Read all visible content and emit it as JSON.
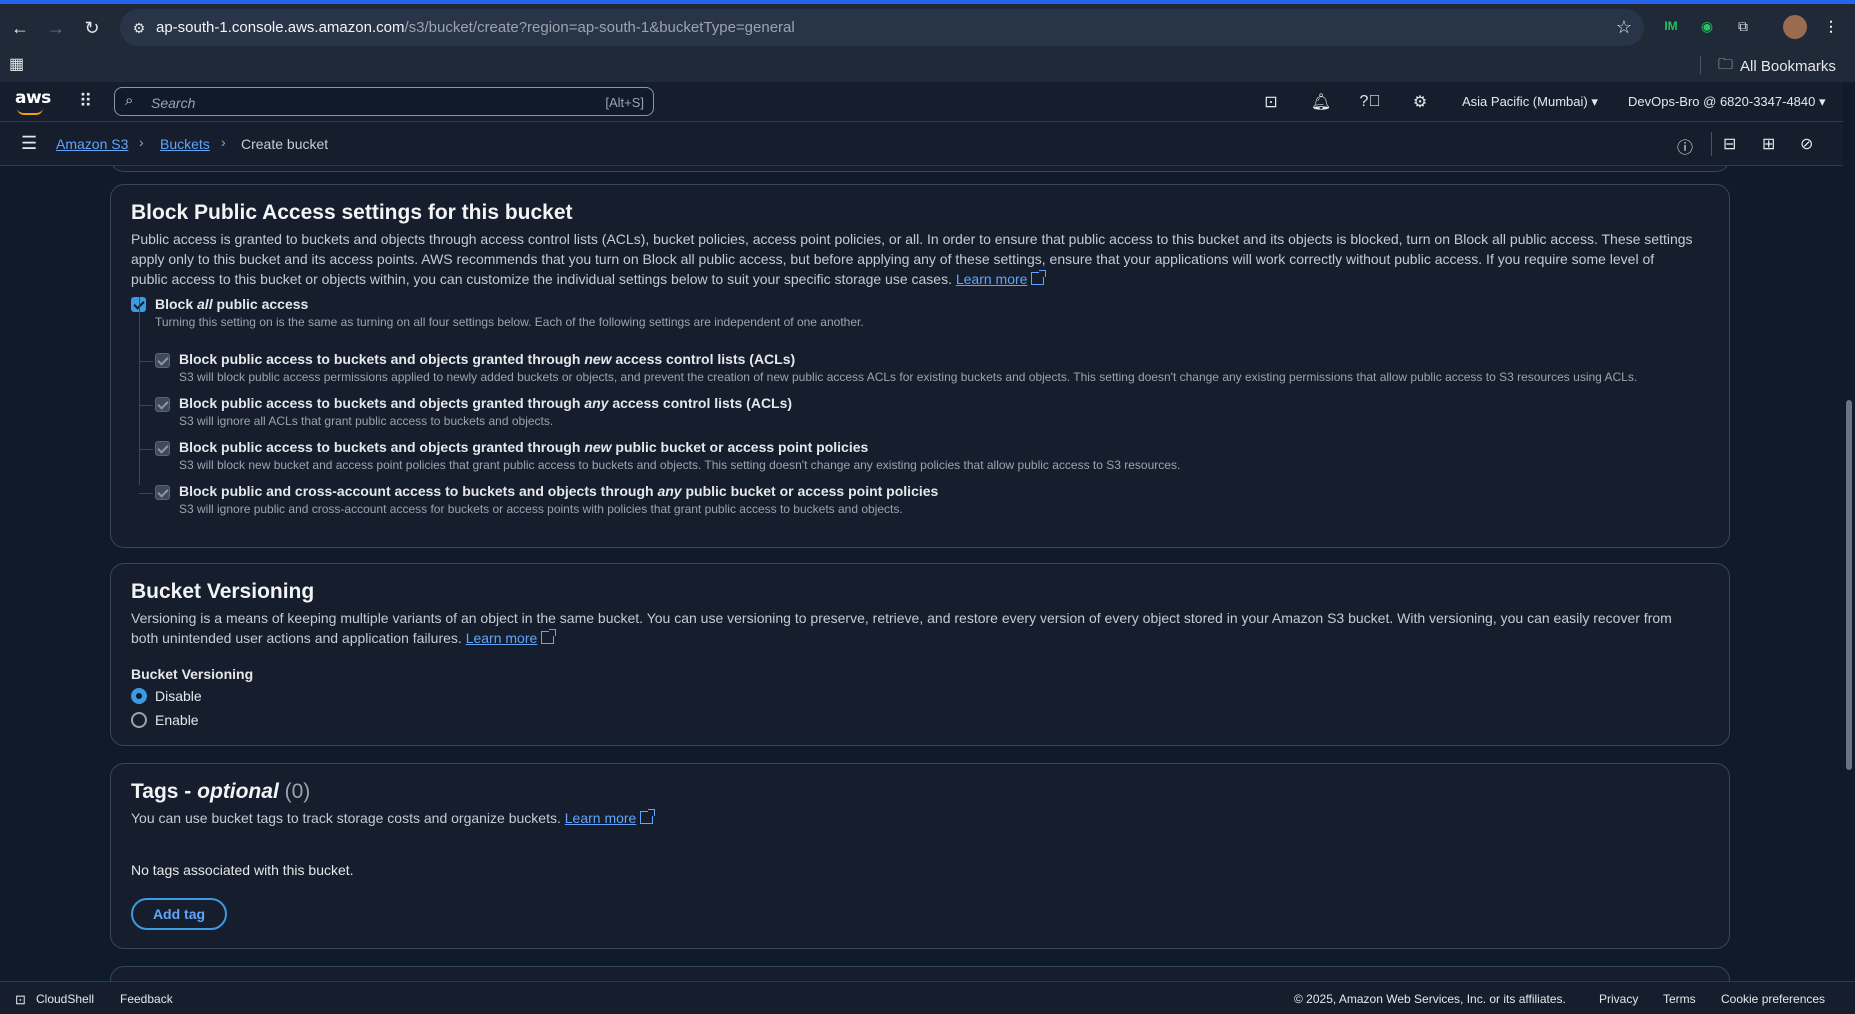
{
  "browser": {
    "url_host": "ap-south-1.console.aws.amazon.com",
    "url_path": "/s3/bucket/create?region=ap-south-1&bucketType=general",
    "all_bookmarks": "All Bookmarks"
  },
  "aws_nav": {
    "logo": "aws",
    "search_placeholder": "Search",
    "search_shortcut": "[Alt+S]",
    "region": "Asia Pacific (Mumbai)",
    "account": "DevOps-Bro @ 6820-3347-4840"
  },
  "breadcrumb": {
    "items": [
      "Amazon S3",
      "Buckets",
      "Create bucket"
    ]
  },
  "block_public_access": {
    "title": "Block Public Access settings for this bucket",
    "description_1": "Public access is granted to buckets and objects through access control lists (ACLs), bucket policies, access point policies, or all. In order to ensure that public access to this bucket and its objects is blocked, turn on Block all public access. These settings",
    "description_2": "apply only to this bucket and its access points. AWS recommends that you turn on Block all public access, but before applying any of these settings, ensure that your applications will work correctly without public access. If you require some level of",
    "description_3": "public access to this bucket or objects within, you can customize the individual settings below to suit your specific storage use cases.",
    "learn_more": "Learn more",
    "block_all_pre": "Block ",
    "block_all_em": "all",
    "block_all_post": " public access",
    "block_all_checked": true,
    "block_all_desc": "Turning this setting on is the same as turning on all four settings below. Each of the following settings are independent of one another.",
    "options": [
      {
        "pre": "Block public access to buckets and objects granted through ",
        "em": "new",
        "post": " access control lists (ACLs)",
        "desc": "S3 will block public access permissions applied to newly added buckets or objects, and prevent the creation of new public access ACLs for existing buckets and objects. This setting doesn't change any existing permissions that allow public access to S3 resources using ACLs."
      },
      {
        "pre": "Block public access to buckets and objects granted through ",
        "em": "any",
        "post": " access control lists (ACLs)",
        "desc": "S3 will ignore all ACLs that grant public access to buckets and objects."
      },
      {
        "pre": "Block public access to buckets and objects granted through ",
        "em": "new",
        "post": " public bucket or access point policies",
        "desc": "S3 will block new bucket and access point policies that grant public access to buckets and objects. This setting doesn't change any existing policies that allow public access to S3 resources."
      },
      {
        "pre": "Block public and cross-account access to buckets and objects through ",
        "em": "any",
        "post": " public bucket or access point policies",
        "desc": "S3 will ignore public and cross-account access for buckets or access points with policies that grant public access to buckets and objects."
      }
    ]
  },
  "versioning": {
    "title": "Bucket Versioning",
    "description_1": "Versioning is a means of keeping multiple variants of an object in the same bucket. You can use versioning to preserve, retrieve, and restore every version of every object stored in your Amazon S3 bucket. With versioning, you can easily recover from",
    "description_2": "both unintended user actions and application failures.",
    "learn_more": "Learn more",
    "field_label": "Bucket Versioning",
    "options": [
      "Disable",
      "Enable"
    ],
    "selected": "Disable"
  },
  "tags": {
    "title": "Tags - ",
    "title_em": "optional",
    "count": "(0)",
    "description": "You can use bucket tags to track storage costs and organize buckets.",
    "learn_more": "Learn more",
    "empty": "No tags associated with this bucket.",
    "add_button": "Add tag"
  },
  "footer": {
    "cloudshell": "CloudShell",
    "feedback": "Feedback",
    "copyright": "© 2025, Amazon Web Services, Inc. or its affiliates.",
    "privacy": "Privacy",
    "terms": "Terms",
    "cookies": "Cookie preferences"
  }
}
